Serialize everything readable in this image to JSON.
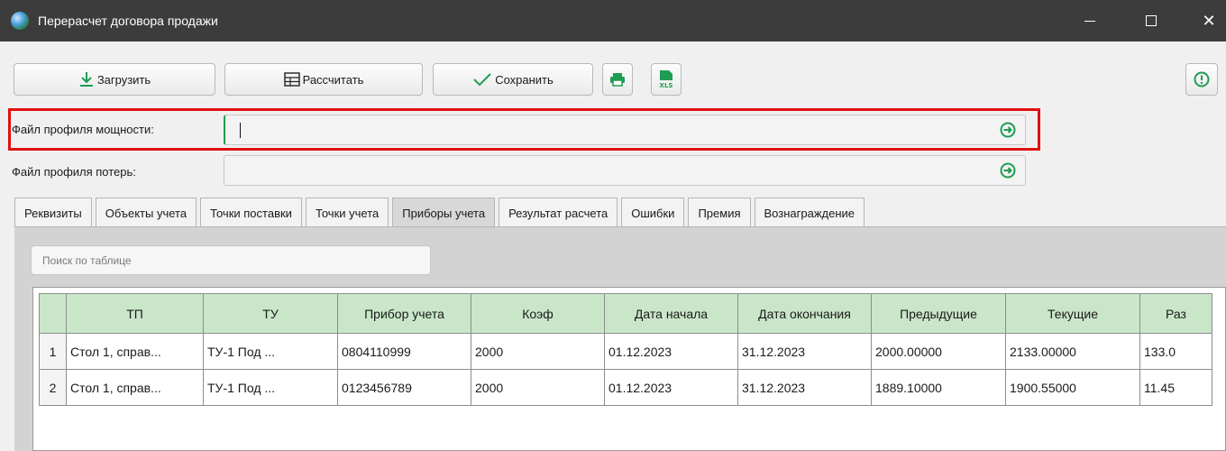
{
  "window": {
    "title": "Перерасчет договора продажи"
  },
  "toolbar": {
    "load_label": "Загрузить",
    "calc_label": "Рассчитать",
    "save_label": "Сохранить"
  },
  "fields": {
    "power_profile_label": "Файл профиля мощности:",
    "power_profile_value": "",
    "loss_profile_label": "Файл профиля потерь:",
    "loss_profile_value": ""
  },
  "tabs": [
    {
      "label": "Реквизиты"
    },
    {
      "label": "Объекты учета"
    },
    {
      "label": "Точки поставки"
    },
    {
      "label": "Точки учета"
    },
    {
      "label": "Приборы учета",
      "active": true
    },
    {
      "label": "Результат расчета"
    },
    {
      "label": "Ошибки"
    },
    {
      "label": "Премия"
    },
    {
      "label": "Вознаграждение"
    }
  ],
  "search": {
    "placeholder": "Поиск по таблице"
  },
  "table": {
    "columns": [
      "",
      "ТП",
      "ТУ",
      "Прибор учета",
      "Коэф",
      "Дата начала",
      "Дата окончания",
      "Предыдущие",
      "Текущие",
      "Раз"
    ],
    "rows": [
      [
        "1",
        "Стол 1, справ...",
        "ТУ-1 Под ...",
        "0804110999",
        "2000",
        "01.12.2023",
        "31.12.2023",
        "2000.00000",
        "2133.00000",
        "133.0"
      ],
      [
        "2",
        "Стол 1, справ...",
        "ТУ-1 Под ...",
        "0123456789",
        "2000",
        "01.12.2023",
        "31.12.2023",
        "1889.10000",
        "1900.55000",
        "11.45"
      ]
    ]
  },
  "colors": {
    "accent_green": "#1e9d52",
    "header_green": "#c9e6c9",
    "highlight_red": "#e01010",
    "titlebar": "#3c3c3c"
  },
  "icons": {
    "load": "download-icon",
    "calc": "table-icon",
    "save": "checkmark-icon",
    "print": "printer-icon",
    "xls": "xls-file-icon",
    "info": "info-icon",
    "go": "arrow-circle-right-icon"
  }
}
